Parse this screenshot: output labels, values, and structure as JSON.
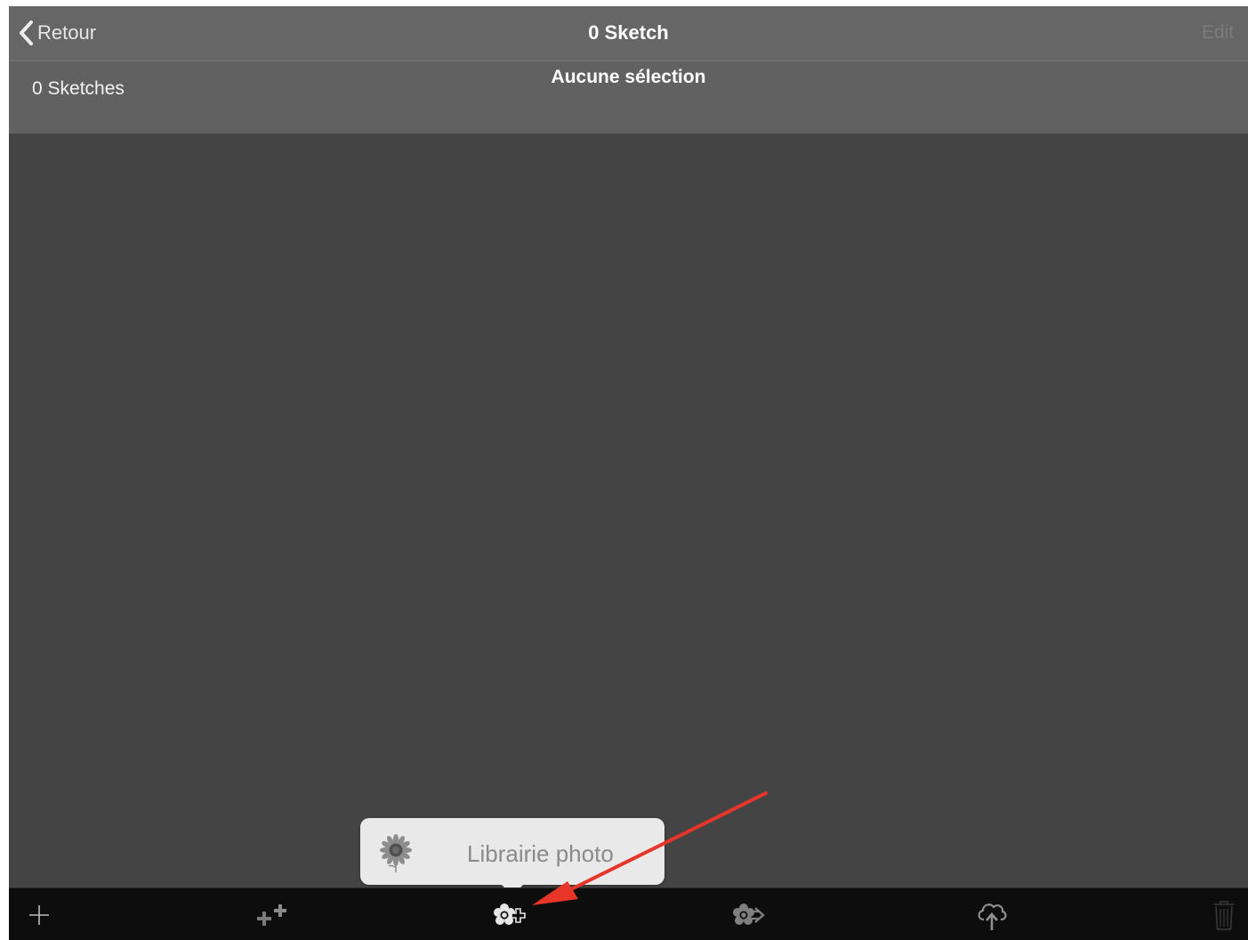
{
  "nav": {
    "back_label": "Retour",
    "title": "0 Sketch",
    "edit_label": "Edit"
  },
  "subheader": {
    "count_label": "0 Sketches",
    "selection_label": "Aucune sélection"
  },
  "popover": {
    "item_label": "Librairie photo",
    "item_icon": "sunflower-icon"
  },
  "toolbar": {
    "items": [
      {
        "icon": "plus-icon"
      },
      {
        "icon": "add-multiple-icon"
      },
      {
        "icon": "photo-library-add-icon"
      },
      {
        "icon": "export-photo-icon"
      },
      {
        "icon": "cloud-upload-icon"
      },
      {
        "icon": "trash-icon"
      }
    ]
  },
  "colors": {
    "nav_background": "#666666",
    "content_background": "#444444",
    "toolbar_background": "#0d0d0d",
    "annotation_arrow": "#e8352a"
  }
}
